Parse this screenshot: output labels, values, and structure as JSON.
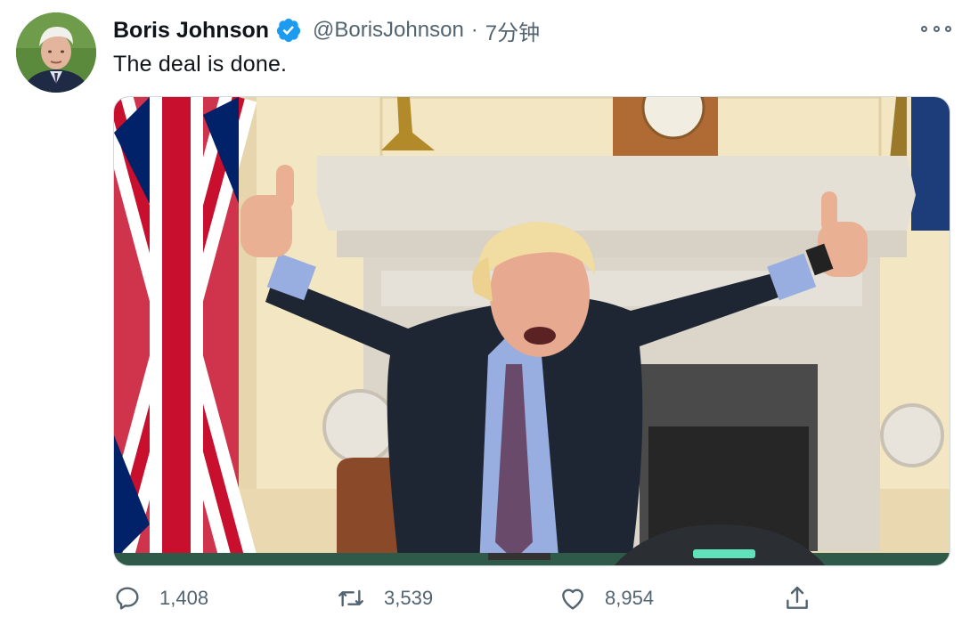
{
  "author": {
    "display_name": "Boris Johnson",
    "handle": "@BorisJohnson",
    "verified": true,
    "avatar_icon": "profile-photo"
  },
  "meta": {
    "separator": "·",
    "timestamp": "7分钟"
  },
  "tweet": {
    "text": "The deal is done."
  },
  "media": {
    "type": "photo",
    "icon": "photo"
  },
  "actions": {
    "reply": {
      "icon": "reply-icon",
      "count": "1,408"
    },
    "retweet": {
      "icon": "retweet-icon",
      "count": "3,539"
    },
    "like": {
      "icon": "heart-icon",
      "count": "8,954"
    },
    "share": {
      "icon": "share-icon"
    }
  },
  "colors": {
    "text_primary": "#0f1419",
    "text_secondary": "#536471",
    "verified_blue": "#1d9bf0",
    "border": "#cfd9de"
  }
}
